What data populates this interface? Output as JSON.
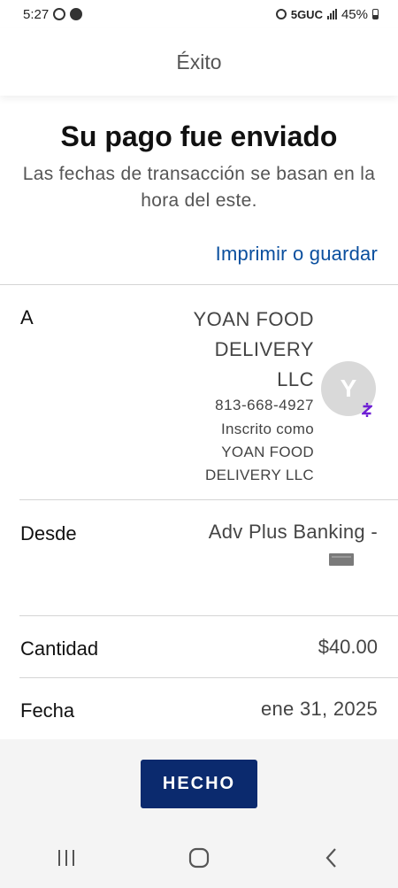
{
  "status_bar": {
    "time": "5:27",
    "network": "5GUC",
    "battery": "45%"
  },
  "header": {
    "title": "Éxito"
  },
  "confirmation": {
    "title": "Su pago fue enviado",
    "subtitle": "Las fechas de transacción se basan en la hora del este.",
    "print_link": "Imprimir o guardar"
  },
  "details": {
    "to": {
      "label": "A",
      "name_lines": [
        "YOAN FOOD",
        "DELIVERY",
        "LLC"
      ],
      "phone": "813-668-4927",
      "enrolled_label": "Inscrito como",
      "enrolled_lines": [
        "YOAN FOOD",
        "DELIVERY LLC"
      ],
      "avatar_initial": "Y",
      "badge_icon": "zelle-icon"
    },
    "from": {
      "label": "Desde",
      "value": "Adv Plus Banking -"
    },
    "amount": {
      "label": "Cantidad",
      "value": "$40.00"
    },
    "date": {
      "label": "Fecha",
      "value": "ene 31, 2025"
    }
  },
  "footer": {
    "done_label": "HECHO"
  },
  "nav": {
    "recents_icon": "recent-apps-icon",
    "home_icon": "home-icon",
    "back_icon": "back-icon"
  },
  "colors": {
    "link": "#0a4f9e",
    "button": "#0b2a6e",
    "zelle": "#6d1ed4"
  }
}
